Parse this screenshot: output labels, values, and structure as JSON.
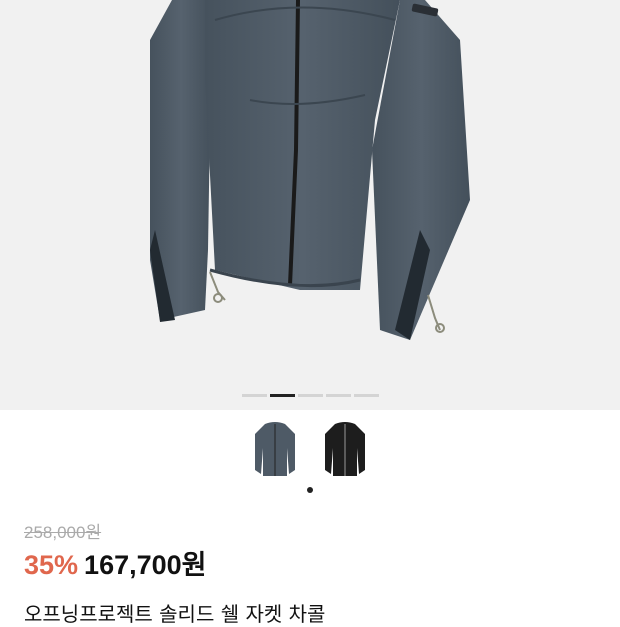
{
  "gallery": {
    "slide_count": 5,
    "active_index": 1
  },
  "thumbnails": [
    {
      "name": "thumbnail-gray-jacket",
      "color": "#4e5a66"
    },
    {
      "name": "thumbnail-black-jacket",
      "color": "#1d1d1d"
    }
  ],
  "product": {
    "original_price": "258,000원",
    "discount": "35%",
    "price": "167,700원",
    "title": "오프닝프로젝트 솔리드 쉘 자켓 차콜"
  },
  "colors": {
    "discount_red": "#e0674d",
    "jacket_body": "#4e5a66"
  }
}
